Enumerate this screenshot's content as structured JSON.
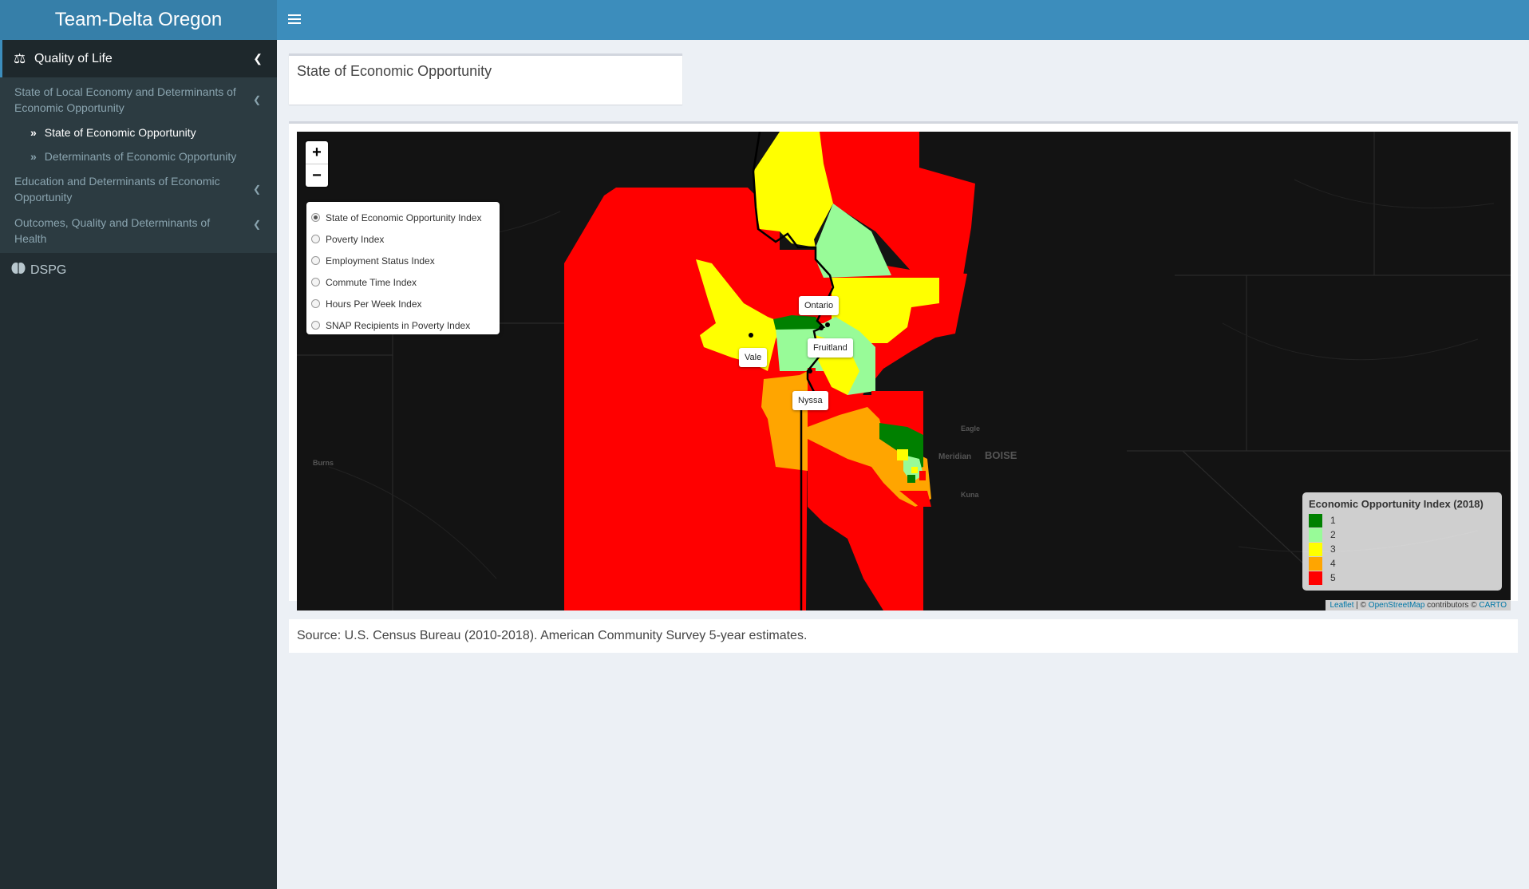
{
  "app": {
    "brand": "Team-Delta Oregon"
  },
  "sidebar": {
    "section": {
      "label": "Quality of Life"
    },
    "items": [
      {
        "label": "State of Local Economy and Determinants of Economic Opportunity"
      },
      {
        "label": "Education and Determinants of Economic Opportunity"
      },
      {
        "label": "Outcomes, Quality and Determinants of Health"
      }
    ],
    "subitems": [
      {
        "label": "State of Economic Opportunity"
      },
      {
        "label": "Determinants of Economic Opportunity"
      }
    ],
    "dspg": {
      "label": "DSPG"
    }
  },
  "page": {
    "title": "State of Economic Opportunity",
    "source": "Source: U.S. Census Bureau (2010-2018). American Community Survey 5-year estimates."
  },
  "map": {
    "zoom_in": "+",
    "zoom_out": "−",
    "layers": [
      {
        "label": "State of Economic Opportunity Index",
        "selected": true
      },
      {
        "label": "Poverty Index",
        "selected": false
      },
      {
        "label": "Employment Status Index",
        "selected": false
      },
      {
        "label": "Commute Time Index",
        "selected": false
      },
      {
        "label": "Hours Per Week Index",
        "selected": false
      },
      {
        "label": "SNAP Recipients in Poverty Index",
        "selected": false
      }
    ],
    "cities": {
      "ontario": "Ontario",
      "fruitland": "Fruitland",
      "vale": "Vale",
      "nyssa": "Nyssa"
    },
    "basemap_labels": {
      "burns": "Burns",
      "eagle": "Eagle",
      "meridian": "Meridian",
      "boise": "BOISE",
      "kuna": "Kuna"
    },
    "legend": {
      "title": "Economic Opportunity Index (2018)",
      "entries": [
        {
          "label": "1",
          "color": "#008000"
        },
        {
          "label": "2",
          "color": "#98fb98"
        },
        {
          "label": "3",
          "color": "#ffff00"
        },
        {
          "label": "4",
          "color": "#ffa500"
        },
        {
          "label": "5",
          "color": "#ff0000"
        }
      ]
    },
    "attribution": {
      "leaflet": "Leaflet",
      "sep1": " | © ",
      "osm": "OpenStreetMap",
      "contrib": " contributors © ",
      "carto": "CARTO"
    }
  }
}
